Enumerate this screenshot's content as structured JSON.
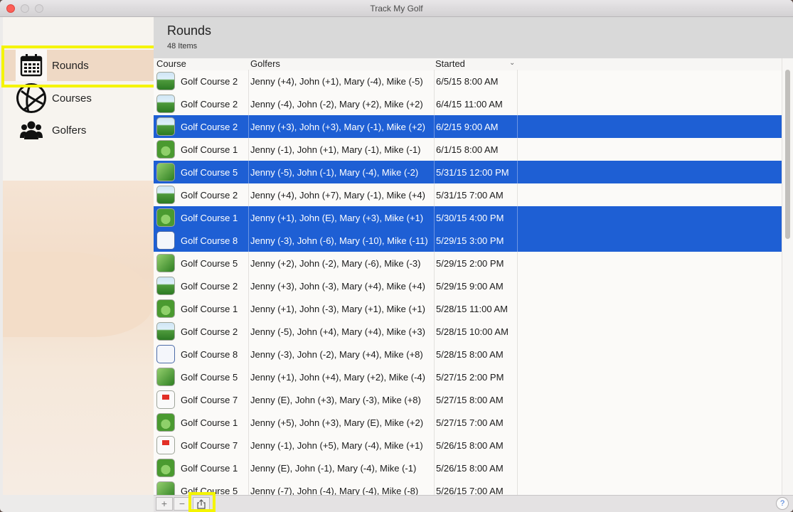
{
  "window": {
    "title": "Track My Golf"
  },
  "sidebar": {
    "items": [
      {
        "label": "Rounds",
        "icon": "calendar-icon",
        "selected": true
      },
      {
        "label": "Courses",
        "icon": "globe-icon",
        "selected": false
      },
      {
        "label": "Golfers",
        "icon": "people-icon",
        "selected": false
      }
    ]
  },
  "header": {
    "title": "Rounds",
    "count": "48 Items"
  },
  "table": {
    "columns": {
      "course": "Course",
      "golfers": "Golfers",
      "started": "Started"
    },
    "sort_column": "Started",
    "rows": [
      {
        "course": "Golf Course 2",
        "golfers": "Jenny (+4), John (+1), Mary (-4), Mike (-5)",
        "started": "6/5/15 8:00 AM",
        "icon": "hill",
        "selected": false
      },
      {
        "course": "Golf Course 2",
        "golfers": "Jenny (-4), John (-2), Mary (+2), Mike (+2)",
        "started": "6/4/15 11:00 AM",
        "icon": "hill",
        "selected": false
      },
      {
        "course": "Golf Course 2",
        "golfers": "Jenny (+3), John (+3), Mary (-1), Mike (+2)",
        "started": "6/2/15 9:00 AM",
        "icon": "hill",
        "selected": true
      },
      {
        "course": "Golf Course 1",
        "golfers": "Jenny (-1), John (+1), Mary (-1), Mike (-1)",
        "started": "6/1/15 8:00 AM",
        "icon": "green1",
        "selected": false
      },
      {
        "course": "Golf Course 5",
        "golfers": "Jenny (-5), John (-1), Mary (-4), Mike (-2)",
        "started": "5/31/15 12:00 PM",
        "icon": "tree",
        "selected": true
      },
      {
        "course": "Golf Course 2",
        "golfers": "Jenny (+4), John (+7), Mary (-1), Mike (+4)",
        "started": "5/31/15 7:00 AM",
        "icon": "hill",
        "selected": false
      },
      {
        "course": "Golf Course 1",
        "golfers": "Jenny (+1), John (E), Mary (+3), Mike (+1)",
        "started": "5/30/15 4:00 PM",
        "icon": "green1",
        "selected": true
      },
      {
        "course": "Golf Course 8",
        "golfers": "Jenny (-3), John (-6), Mary (-10), Mike (-11)",
        "started": "5/29/15 3:00 PM",
        "icon": "golfer",
        "selected": true
      },
      {
        "course": "Golf Course 5",
        "golfers": "Jenny (+2), John (-2), Mary (-6), Mike (-3)",
        "started": "5/29/15 2:00 PM",
        "icon": "tree",
        "selected": false
      },
      {
        "course": "Golf Course 2",
        "golfers": "Jenny (+3), John (-3), Mary (+4), Mike (+4)",
        "started": "5/29/15 9:00 AM",
        "icon": "hill",
        "selected": false
      },
      {
        "course": "Golf Course 1",
        "golfers": "Jenny (+1), John (-3), Mary (+1), Mike (+1)",
        "started": "5/28/15 11:00 AM",
        "icon": "green1",
        "selected": false
      },
      {
        "course": "Golf Course 2",
        "golfers": "Jenny (-5), John (+4), Mary (+4), Mike (+3)",
        "started": "5/28/15 10:00 AM",
        "icon": "hill",
        "selected": false
      },
      {
        "course": "Golf Course 8",
        "golfers": "Jenny (-3), John (-2), Mary (+4), Mike (+8)",
        "started": "5/28/15 8:00 AM",
        "icon": "golfer",
        "selected": false
      },
      {
        "course": "Golf Course 5",
        "golfers": "Jenny (+1), John (+4), Mary (+2), Mike (-4)",
        "started": "5/27/15 2:00 PM",
        "icon": "tree",
        "selected": false
      },
      {
        "course": "Golf Course 7",
        "golfers": "Jenny (E), John (+3), Mary (-3), Mike (+8)",
        "started": "5/27/15 8:00 AM",
        "icon": "flag",
        "selected": false
      },
      {
        "course": "Golf Course 1",
        "golfers": "Jenny (+5), John (+3), Mary (E), Mike (+2)",
        "started": "5/27/15 7:00 AM",
        "icon": "green1",
        "selected": false
      },
      {
        "course": "Golf Course 7",
        "golfers": "Jenny (-1), John (+5), Mary (-4), Mike (+1)",
        "started": "5/26/15 8:00 AM",
        "icon": "flag",
        "selected": false
      },
      {
        "course": "Golf Course 1",
        "golfers": "Jenny (E), John (-1), Mary (-4), Mike (-1)",
        "started": "5/26/15 8:00 AM",
        "icon": "green1",
        "selected": false
      },
      {
        "course": "Golf Course 5",
        "golfers": "Jenny (-7), John (-4), Mary (-4), Mike (-8)",
        "started": "5/26/15 7:00 AM",
        "icon": "tree",
        "selected": false
      }
    ]
  },
  "toolbar": {
    "add_label": "+",
    "remove_label": "−",
    "share_icon": "share-icon",
    "help_label": "?"
  },
  "colors": {
    "selection": "#1e5fd4",
    "highlight": "#f4f400",
    "close": "#fc5f57"
  }
}
